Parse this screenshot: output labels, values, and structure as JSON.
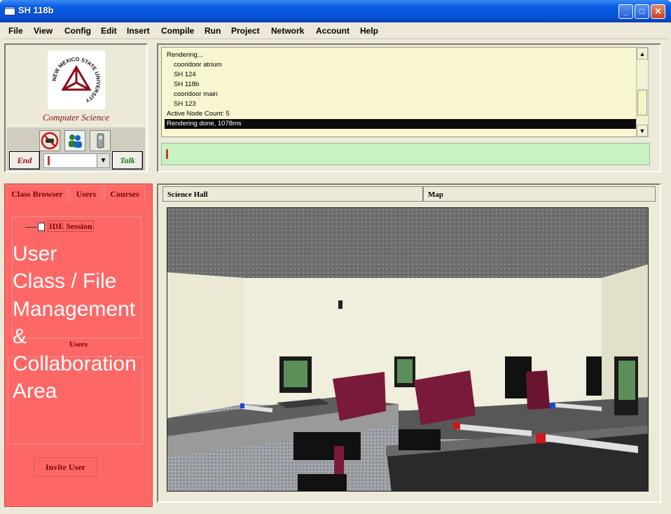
{
  "window": {
    "title": "SH 118b",
    "minimize": "_",
    "maximize": "□",
    "close": "✕"
  },
  "menu": [
    "File",
    "View",
    "Config",
    "Edit",
    "Insert",
    "Compile",
    "Run",
    "Project",
    "Network",
    "Account",
    "Help"
  ],
  "logo": {
    "arc_text": "NEW MEXICO STATE UNIVERSITY",
    "department": "Computer Science"
  },
  "controls": {
    "end_label": "End",
    "talk_label": "Talk",
    "icons": [
      "no-phone-icon",
      "users-icon",
      "handset-icon"
    ]
  },
  "console": {
    "lines": [
      {
        "text": "Rendering...",
        "indent": false
      },
      {
        "text": "cooridoor atrium",
        "indent": true
      },
      {
        "text": "SH 124",
        "indent": true
      },
      {
        "text": "SH 118b",
        "indent": true
      },
      {
        "text": "cooridoor main",
        "indent": true
      },
      {
        "text": "SH 123",
        "indent": true
      },
      {
        "text": "Active Node Count: 5",
        "indent": false
      },
      {
        "text": "Rendering done, 1078ms",
        "indent": false,
        "selected": true
      }
    ]
  },
  "left_tabs": [
    "Class Browser",
    "Users",
    "Courses"
  ],
  "tree": {
    "node_label": "IDE Session"
  },
  "users_section": {
    "label": "Users"
  },
  "invite_label": "Invite User",
  "overlay": {
    "text": "User\nClass / File\nManagement\n&\nCollaboration\nArea",
    "color": "#fd6866"
  },
  "view_tabs": [
    "Science Hall",
    "Map"
  ],
  "colors": {
    "console_bg": "#f8f6d0",
    "input_bg": "#c9f2c4",
    "accent_red": "#8a0d17"
  }
}
